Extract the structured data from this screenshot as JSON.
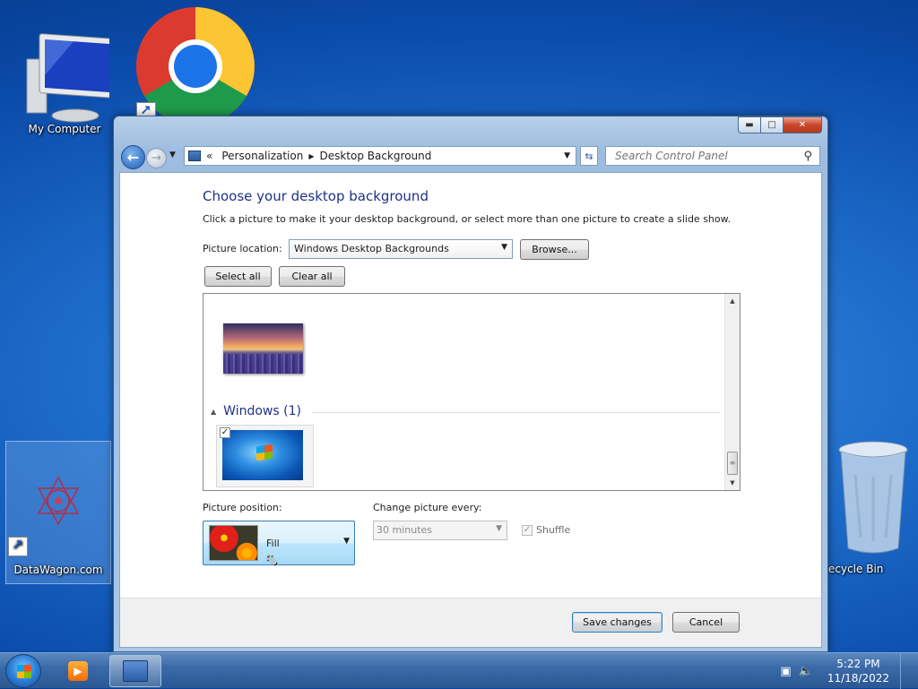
{
  "desktop": {
    "icons": {
      "my_computer": "My Computer",
      "datawagon": "DataWagon.com",
      "recycle_bin": "ecycle Bin"
    }
  },
  "window": {
    "address": {
      "crumbs": [
        "Personalization",
        "Desktop Background"
      ],
      "prefix": "«"
    },
    "search": {
      "placeholder": "Search Control Panel"
    },
    "content": {
      "title": "Choose your desktop background",
      "description": "Click a picture to make it your desktop background, or select more than one picture to create a slide show.",
      "picture_location_label": "Picture location:",
      "picture_location_value": "Windows Desktop Backgrounds",
      "browse_label": "Browse...",
      "select_all_label": "Select all",
      "clear_all_label": "Clear all",
      "group_heading": "Windows (1)",
      "picture_position_label": "Picture position:",
      "picture_position_value": "Fill",
      "change_every_label": "Change picture every:",
      "change_every_value": "30 minutes",
      "shuffle_label": "Shuffle",
      "save_label": "Save changes",
      "cancel_label": "Cancel"
    }
  },
  "taskbar": {
    "time": "5:22 PM",
    "date": "11/18/2022"
  },
  "colors": {
    "title_blue": "#1e3287",
    "desktop_blue": "#1d6bc9"
  }
}
